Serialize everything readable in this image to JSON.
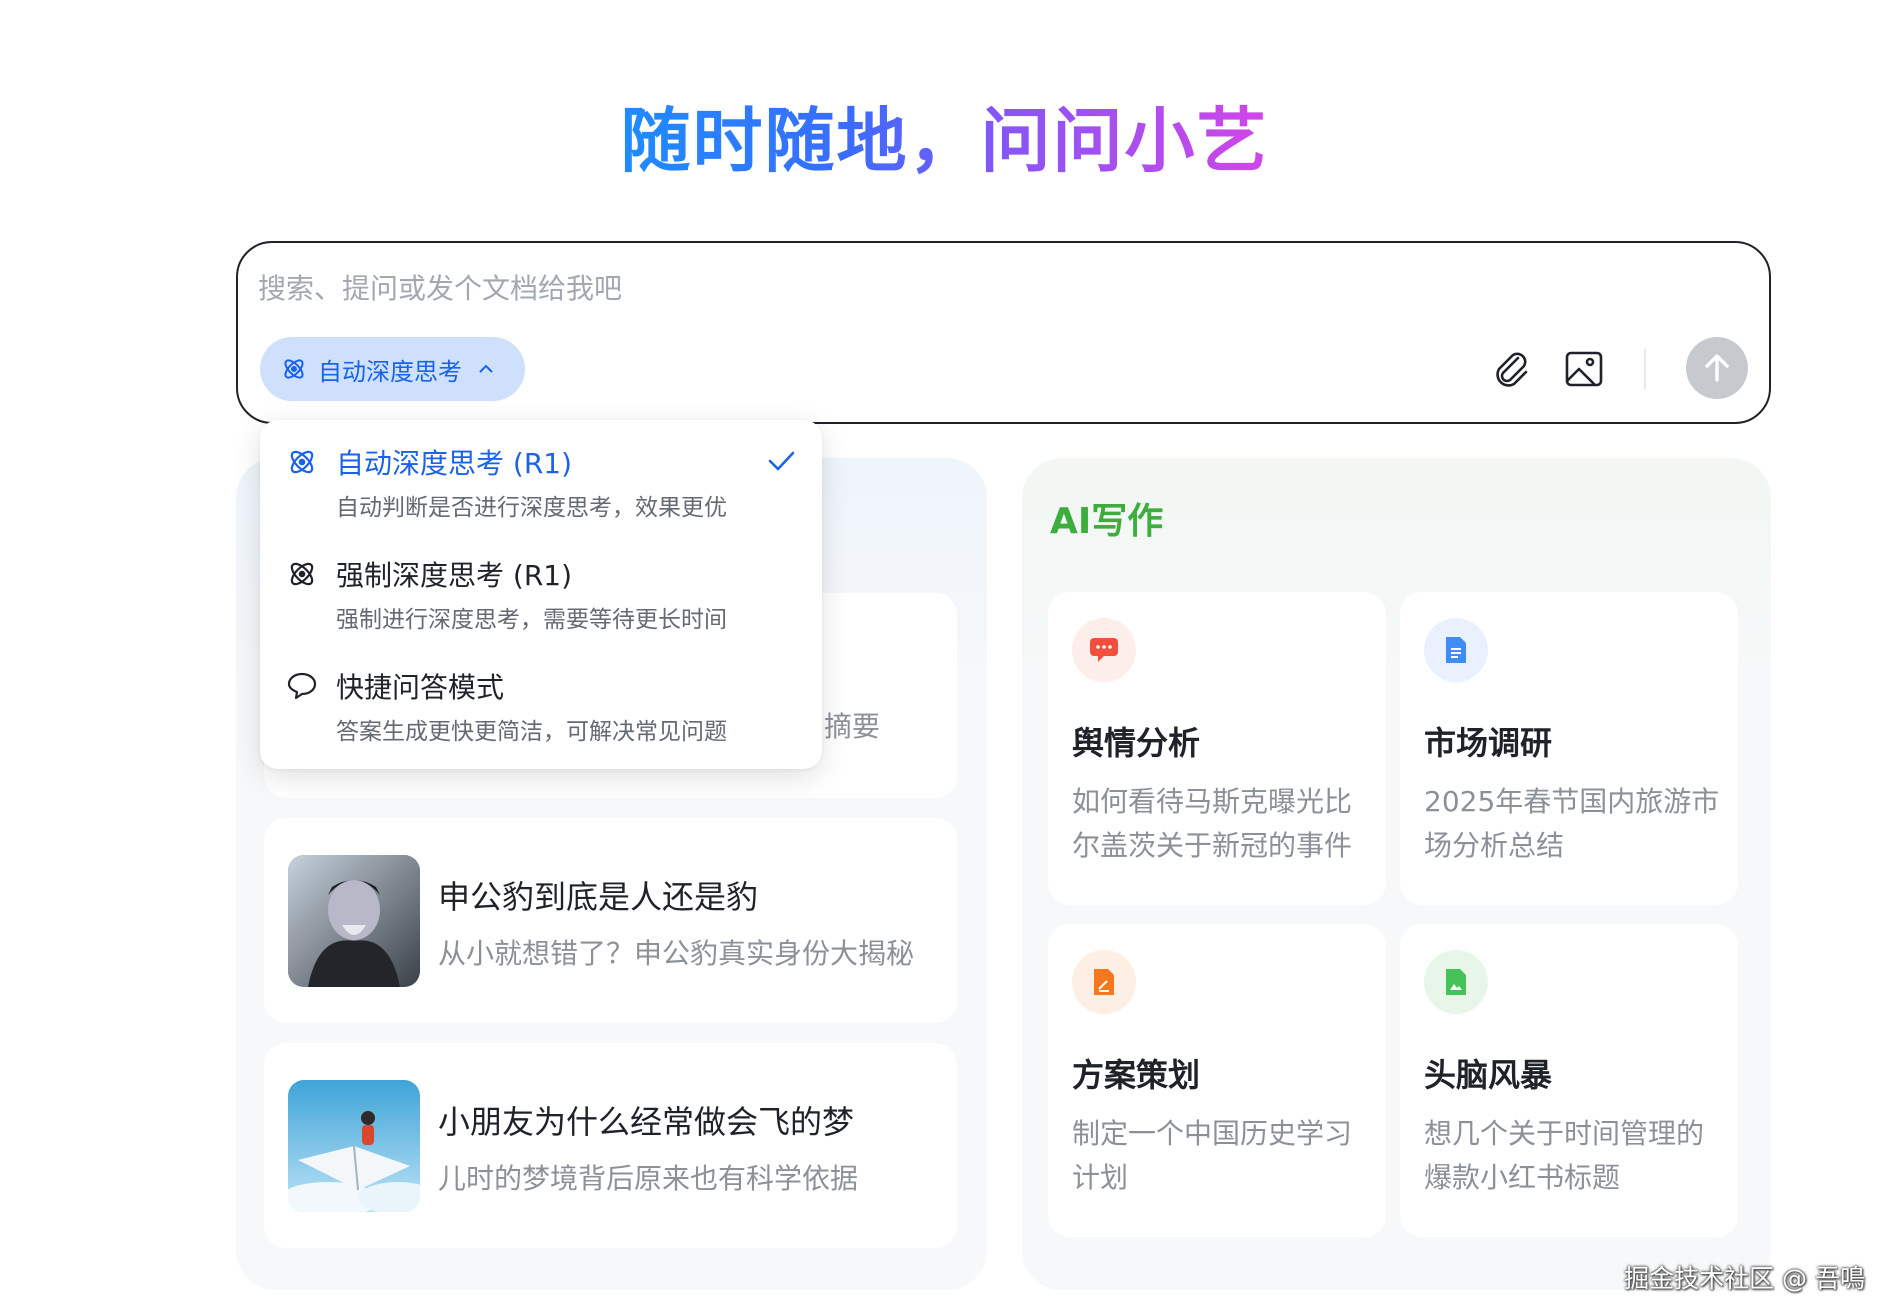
{
  "hero": {
    "title": "随时随地，问问小艺"
  },
  "search": {
    "placeholder": "搜索、提问或发个文档给我吧",
    "mode_chip_label": "自动深度思考"
  },
  "dropdown": {
    "items": [
      {
        "title": "自动深度思考 (R1)",
        "subtitle": "自动判断是否进行深度思考，效果更优",
        "selected": true
      },
      {
        "title": "强制深度思考 (R1)",
        "subtitle": "强制进行深度思考，需要等待更长时间"
      },
      {
        "title": "快捷问答模式",
        "subtitle": "答案生成更快更简洁，可解决常见问题"
      }
    ]
  },
  "left_panel": {
    "cards": [
      {
        "partial_text": "摘要"
      },
      {
        "title": "申公豹到底是人还是豹",
        "subtitle": "从小就想错了？申公豹真实身份大揭秘"
      },
      {
        "title": "小朋友为什么经常做会飞的梦",
        "subtitle": "儿时的梦境背后原来也有科学依据"
      }
    ]
  },
  "right_panel": {
    "title": "AI写作",
    "cards": [
      {
        "title": "舆情分析",
        "desc": "如何看待马斯克曝光比尔盖茨关于新冠的事件",
        "icon": "chat-bubble-icon",
        "color": "#f0503c"
      },
      {
        "title": "市场调研",
        "desc": "2025年春节国内旅游市场分析总结",
        "icon": "document-icon",
        "color": "#3d8df5"
      },
      {
        "title": "方案策划",
        "desc": "制定一个中国历史学习计划",
        "icon": "edit-file-icon",
        "color": "#f5781e"
      },
      {
        "title": "头脑风暴",
        "desc": "想几个关于时间管理的爆款小红书标题",
        "icon": "image-file-icon",
        "color": "#45c35a"
      }
    ]
  },
  "watermark": "掘金技术社区 @ 吾鳴"
}
